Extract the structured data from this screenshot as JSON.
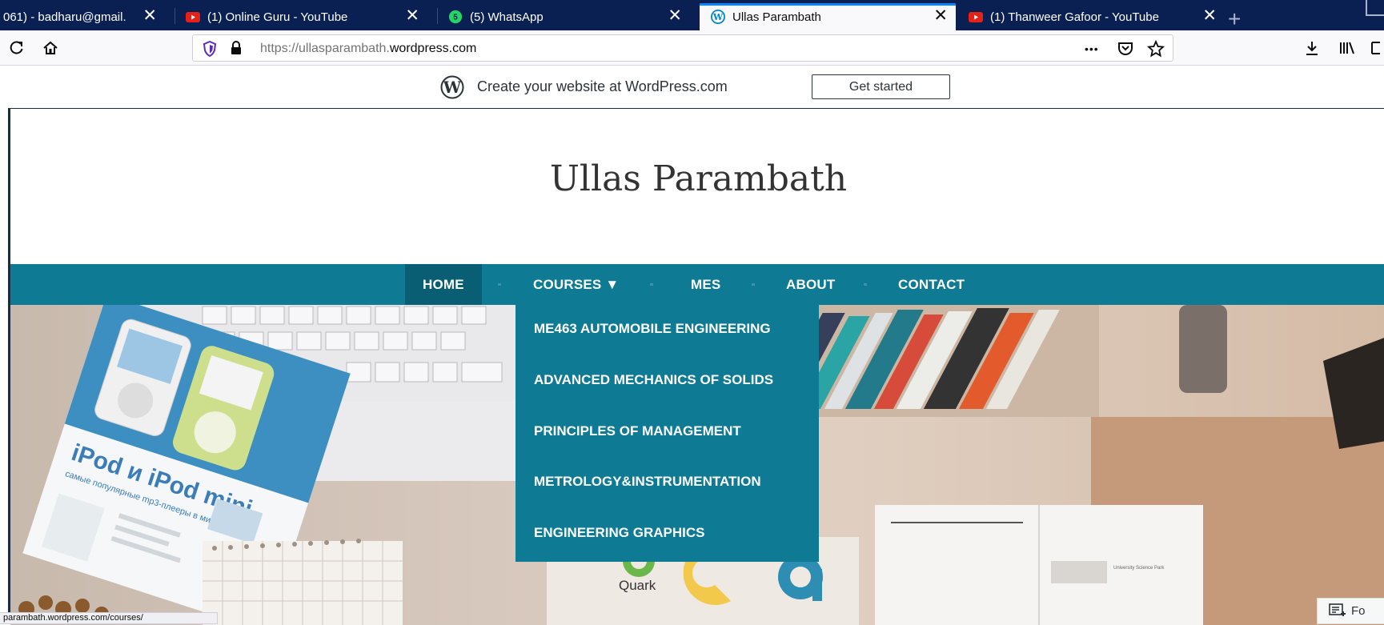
{
  "browser": {
    "tabs": [
      {
        "title": "061) - badharu@gmail.",
        "favicon": "mail-icon"
      },
      {
        "title": "(1) Online Guru - YouTube",
        "favicon": "youtube-icon"
      },
      {
        "title": "(5) WhatsApp",
        "favicon": "whatsapp-icon",
        "badge": "5"
      },
      {
        "title": "Ullas Parambath",
        "favicon": "wordpress-icon",
        "active": true
      },
      {
        "title": "(1) Thanweer Gafoor - YouTube",
        "favicon": "youtube-icon"
      }
    ],
    "close_glyph": "✕",
    "new_tab_glyph": "+",
    "url_prefix": "https://ullasparambath.",
    "url_domain": "wordpress.com",
    "url_more": "•••",
    "status_url": "parambath.wordpress.com/courses/"
  },
  "banner": {
    "text": "Create your website at WordPress.com",
    "button": "Get started"
  },
  "site": {
    "title": "Ullas Parambath",
    "nav": [
      {
        "label": "HOME"
      },
      {
        "label": "COURSES ▼"
      },
      {
        "label": "MES"
      },
      {
        "label": "ABOUT"
      },
      {
        "label": "CONTACT"
      }
    ],
    "courses_menu": [
      "ME463 AUTOMOBILE ENGINEERING",
      "ADVANCED MECHANICS OF SOLIDS",
      "PRINCIPLES OF MANAGEMENT",
      "METROLOGY&INSTRUMENTATION",
      "ENGINEERING GRAPHICS"
    ],
    "hero_text": {
      "ipod": "iPod и iPod mini",
      "ipod_sub": "самые популярные mp3-плееры в мире",
      "quark": "Quark",
      "usp": "University Science Park"
    },
    "follow_label": "Fo"
  },
  "colors": {
    "tabstrip": "#0a1f52",
    "nav": "#0e7a94",
    "nav_current": "#0a5e73",
    "accent": "#0a84ff"
  }
}
